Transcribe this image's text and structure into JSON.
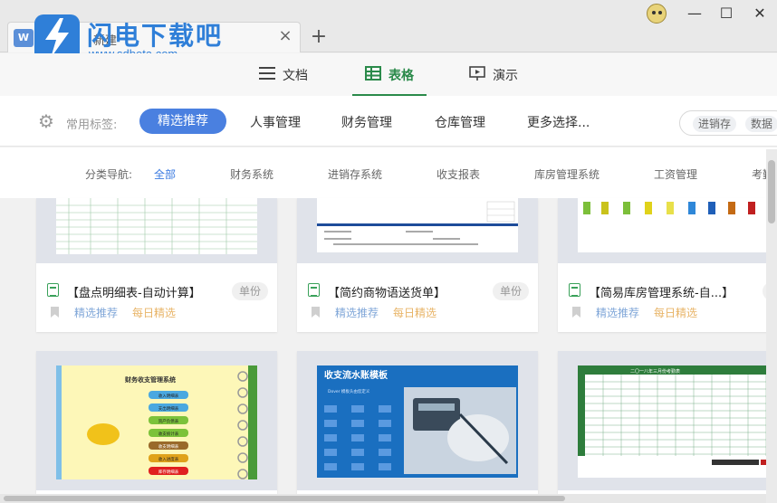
{
  "tab": {
    "logo": "W",
    "title": "新建",
    "close": "×",
    "add": "+"
  },
  "watermark": {
    "text": "闪电下载吧",
    "url": "www.sdbeta.com"
  },
  "window": {
    "minimize": "—",
    "maximize": "☐",
    "close": "✕"
  },
  "nav": {
    "items": [
      {
        "label": "文档",
        "icon": "document-icon"
      },
      {
        "label": "表格",
        "icon": "table-icon"
      },
      {
        "label": "演示",
        "icon": "presentation-icon"
      }
    ]
  },
  "tags": {
    "label": "常用标签:",
    "selected": "精选推荐",
    "items": [
      "人事管理",
      "财务管理",
      "仓库管理",
      "更多选择..."
    ],
    "search_chips": [
      "进销存",
      "数据"
    ]
  },
  "categories": {
    "label": "分类导航:",
    "items": [
      "全部",
      "财务系统",
      "进销存系统",
      "收支报表",
      "库房管理系统",
      "工资管理",
      "考勤"
    ]
  },
  "cards_row1": [
    {
      "title": "【盘点明细表-自动计算】",
      "badge": "单份",
      "tag_a": "精选推荐",
      "tag_b": "每日精选"
    },
    {
      "title": "【简约商物语送货单】",
      "badge": "单份",
      "tag_a": "精选推荐",
      "tag_b": "每日精选"
    },
    {
      "title": "【简易库房管理系统-自...】",
      "badge": "单份",
      "tag_a": "精选推荐",
      "tag_b": "每日精选"
    }
  ],
  "thumbs": {
    "finance_title": "财务收支管理系统",
    "finance_buttons": [
      "收入明细表",
      "支出明细表",
      "资产负债表",
      "收支统计表",
      "收支明细表",
      "收入进度表",
      "库存明细表"
    ],
    "cashflow_title": "收支流水账模板",
    "cashflow_sub": "Dover 模板头由您定义",
    "attendance_title": "二〇一八年三月份考勤表"
  },
  "colors": {
    "accent_blue": "#4a80e0",
    "accent_green": "#2a8a4a",
    "watermark": "#2f7fd8"
  }
}
